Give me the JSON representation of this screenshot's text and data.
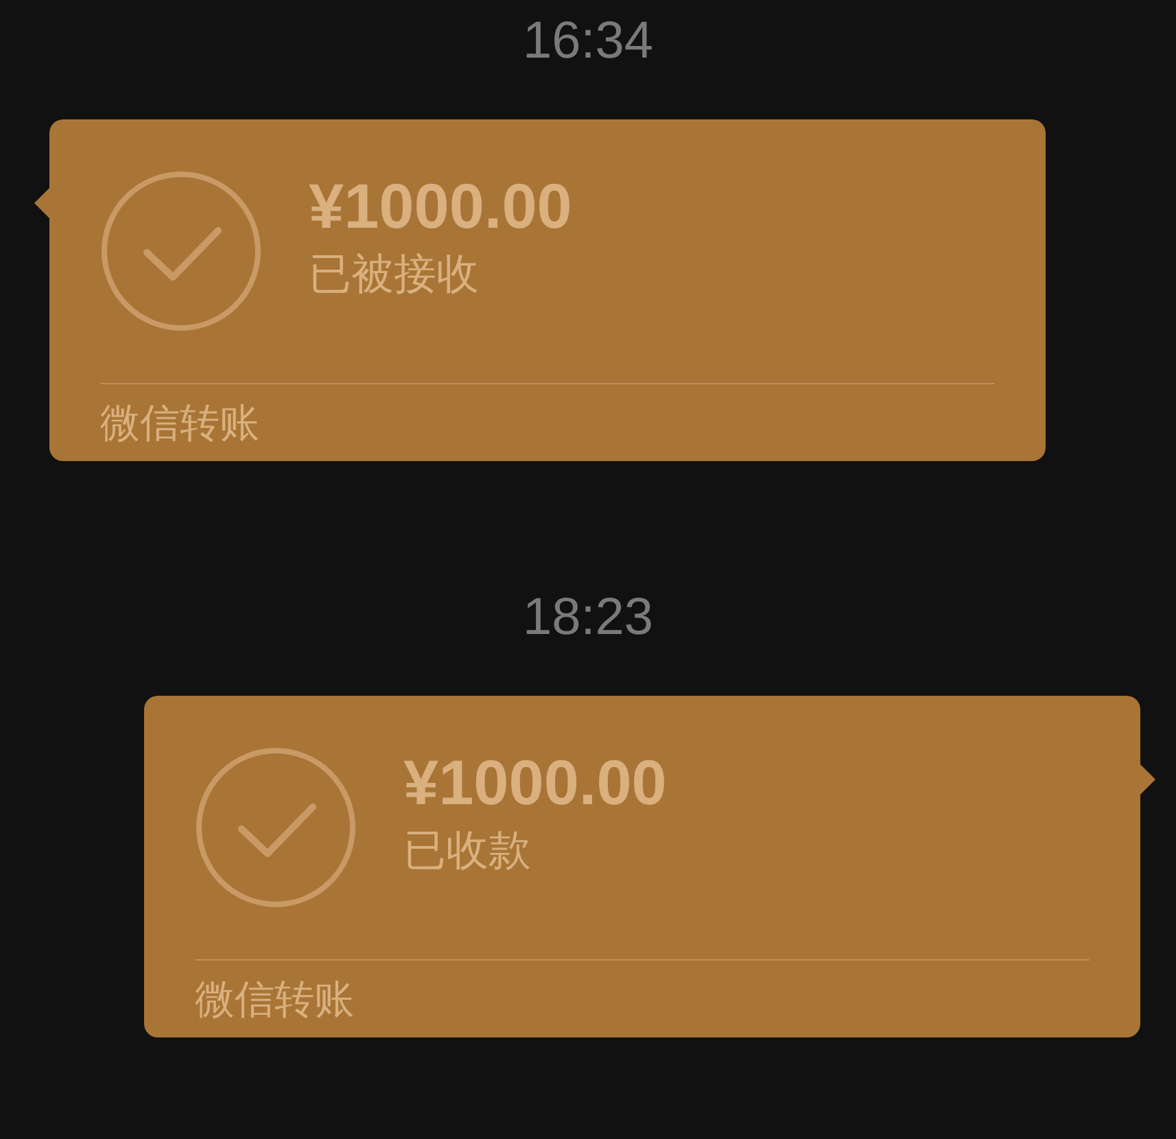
{
  "messages": [
    {
      "time": "16:34",
      "transfer": {
        "kind": "incoming",
        "amount": "¥1000.00",
        "status": "已被接收",
        "footer": "微信转账"
      }
    },
    {
      "time": "18:23",
      "transfer": {
        "kind": "outgoing",
        "amount": "¥1000.00",
        "status": "已收款",
        "footer": "微信转账"
      }
    }
  ]
}
